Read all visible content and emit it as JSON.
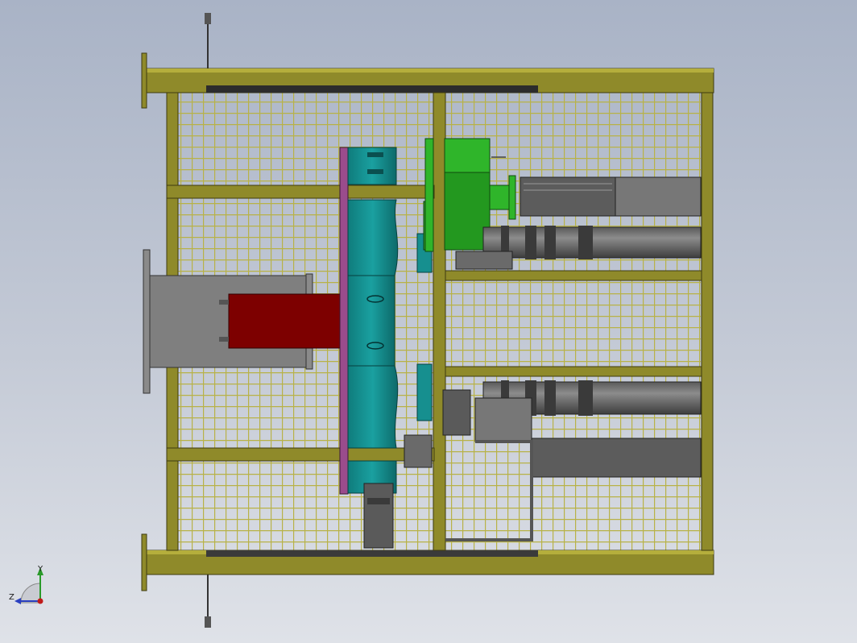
{
  "view": {
    "orientation_labels": {
      "y": "Y",
      "z": "Z"
    }
  },
  "colors": {
    "background_top": "#a9b3c6",
    "background_bottom": "#dfe2e8",
    "frame": "#8f8a2a",
    "frame_highlight": "#b5ae3c",
    "mesh": "#b8b247",
    "teal": "#168f8f",
    "teal_dark": "#0d6868",
    "green": "#2fb52a",
    "red": "#7d0000",
    "gray_block": "#7f7f7f",
    "gray_dark": "#4d4d4d",
    "purple": "#9a4c8c"
  },
  "icons": [
    "axis-triad-icon",
    "bolt-rod-icon"
  ]
}
